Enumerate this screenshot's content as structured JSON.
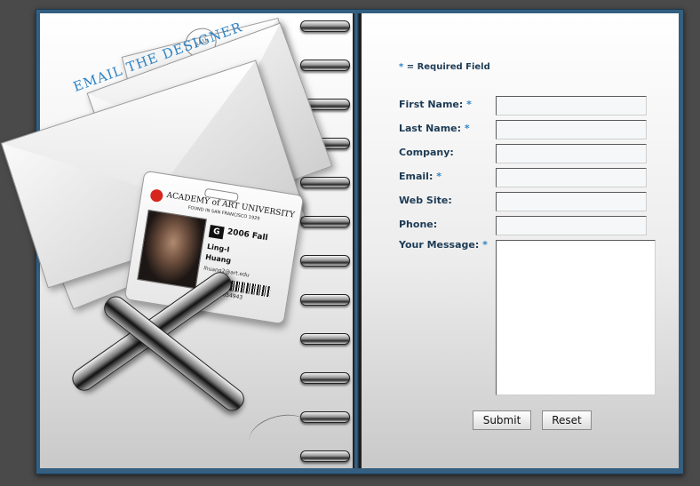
{
  "illustration": {
    "envelope_title": "EMAIL THE DESIGNER",
    "stamp_text": "AAU",
    "badge": {
      "school": "ACADEMY of ART UNIVERSITY",
      "founded": "FOUND IN SAN FRANCISCO 1929",
      "grade_letter": "G",
      "term": "2006 Fall",
      "first_name": "Ling-I",
      "last_name": "Huang",
      "email": "lhuang2@art.edu",
      "id_number": "01054943"
    }
  },
  "form": {
    "required_note_star": "*",
    "required_note": "= Required Field",
    "fields": [
      {
        "label": "First Name:",
        "required": "*",
        "value": ""
      },
      {
        "label": "Last Name:",
        "required": "*",
        "value": ""
      },
      {
        "label": "Company:",
        "required": "",
        "value": ""
      },
      {
        "label": "Email:",
        "required": "*",
        "value": ""
      },
      {
        "label": "Web Site:",
        "required": "",
        "value": ""
      },
      {
        "label": "Phone:",
        "required": "",
        "value": ""
      }
    ],
    "message": {
      "label": "Your Message:",
      "required": "*",
      "value": ""
    },
    "submit_label": "Submit",
    "reset_label": "Reset"
  },
  "colors": {
    "frame": "#345f80",
    "label_text": "#1d3b55",
    "accent_star": "#2f84c4",
    "envelope_title": "#2f84c4"
  }
}
